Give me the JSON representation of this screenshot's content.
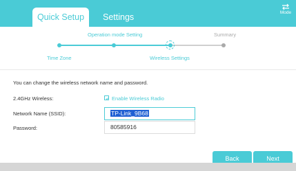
{
  "header": {
    "tabs": [
      {
        "label": "Quick Setup",
        "active": true
      },
      {
        "label": "Settings",
        "active": false
      }
    ],
    "mode": {
      "label": "Mode",
      "icon": "swap-arrows-icon"
    }
  },
  "stepper": {
    "steps": [
      {
        "label": "Time Zone",
        "state": "done"
      },
      {
        "label": "Operation mode Setting",
        "state": "done"
      },
      {
        "label": "Wireless Settings",
        "state": "current"
      },
      {
        "label": "Summary",
        "state": "pending"
      }
    ]
  },
  "form": {
    "intro": "You can change the wireless network name and password.",
    "wireless": {
      "label": "2.4GHz Wireless:",
      "checkbox_label": "Enable Wireless Radio",
      "checked": true
    },
    "ssid": {
      "label": "Network Name (SSID):",
      "value": "TP-Link_9B68"
    },
    "password": {
      "label": "Password:",
      "value": "80585916"
    }
  },
  "buttons": {
    "back": "Back",
    "next": "Next"
  },
  "colors": {
    "accent": "#4acbd6",
    "selection": "#1e5fd3",
    "pending": "#aaaaaa"
  }
}
